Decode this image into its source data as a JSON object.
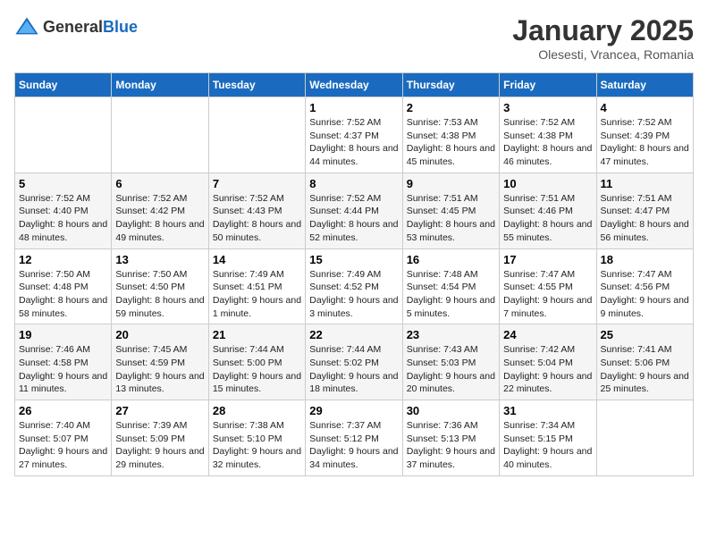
{
  "logo": {
    "general": "General",
    "blue": "Blue"
  },
  "title": {
    "month": "January 2025",
    "location": "Olesesti, Vrancea, Romania"
  },
  "weekdays": [
    "Sunday",
    "Monday",
    "Tuesday",
    "Wednesday",
    "Thursday",
    "Friday",
    "Saturday"
  ],
  "weeks": [
    [
      {
        "day": "",
        "sunrise": "",
        "sunset": "",
        "daylight": ""
      },
      {
        "day": "",
        "sunrise": "",
        "sunset": "",
        "daylight": ""
      },
      {
        "day": "",
        "sunrise": "",
        "sunset": "",
        "daylight": ""
      },
      {
        "day": "1",
        "sunrise": "Sunrise: 7:52 AM",
        "sunset": "Sunset: 4:37 PM",
        "daylight": "Daylight: 8 hours and 44 minutes."
      },
      {
        "day": "2",
        "sunrise": "Sunrise: 7:53 AM",
        "sunset": "Sunset: 4:38 PM",
        "daylight": "Daylight: 8 hours and 45 minutes."
      },
      {
        "day": "3",
        "sunrise": "Sunrise: 7:52 AM",
        "sunset": "Sunset: 4:38 PM",
        "daylight": "Daylight: 8 hours and 46 minutes."
      },
      {
        "day": "4",
        "sunrise": "Sunrise: 7:52 AM",
        "sunset": "Sunset: 4:39 PM",
        "daylight": "Daylight: 8 hours and 47 minutes."
      }
    ],
    [
      {
        "day": "5",
        "sunrise": "Sunrise: 7:52 AM",
        "sunset": "Sunset: 4:40 PM",
        "daylight": "Daylight: 8 hours and 48 minutes."
      },
      {
        "day": "6",
        "sunrise": "Sunrise: 7:52 AM",
        "sunset": "Sunset: 4:42 PM",
        "daylight": "Daylight: 8 hours and 49 minutes."
      },
      {
        "day": "7",
        "sunrise": "Sunrise: 7:52 AM",
        "sunset": "Sunset: 4:43 PM",
        "daylight": "Daylight: 8 hours and 50 minutes."
      },
      {
        "day": "8",
        "sunrise": "Sunrise: 7:52 AM",
        "sunset": "Sunset: 4:44 PM",
        "daylight": "Daylight: 8 hours and 52 minutes."
      },
      {
        "day": "9",
        "sunrise": "Sunrise: 7:51 AM",
        "sunset": "Sunset: 4:45 PM",
        "daylight": "Daylight: 8 hours and 53 minutes."
      },
      {
        "day": "10",
        "sunrise": "Sunrise: 7:51 AM",
        "sunset": "Sunset: 4:46 PM",
        "daylight": "Daylight: 8 hours and 55 minutes."
      },
      {
        "day": "11",
        "sunrise": "Sunrise: 7:51 AM",
        "sunset": "Sunset: 4:47 PM",
        "daylight": "Daylight: 8 hours and 56 minutes."
      }
    ],
    [
      {
        "day": "12",
        "sunrise": "Sunrise: 7:50 AM",
        "sunset": "Sunset: 4:48 PM",
        "daylight": "Daylight: 8 hours and 58 minutes."
      },
      {
        "day": "13",
        "sunrise": "Sunrise: 7:50 AM",
        "sunset": "Sunset: 4:50 PM",
        "daylight": "Daylight: 8 hours and 59 minutes."
      },
      {
        "day": "14",
        "sunrise": "Sunrise: 7:49 AM",
        "sunset": "Sunset: 4:51 PM",
        "daylight": "Daylight: 9 hours and 1 minute."
      },
      {
        "day": "15",
        "sunrise": "Sunrise: 7:49 AM",
        "sunset": "Sunset: 4:52 PM",
        "daylight": "Daylight: 9 hours and 3 minutes."
      },
      {
        "day": "16",
        "sunrise": "Sunrise: 7:48 AM",
        "sunset": "Sunset: 4:54 PM",
        "daylight": "Daylight: 9 hours and 5 minutes."
      },
      {
        "day": "17",
        "sunrise": "Sunrise: 7:47 AM",
        "sunset": "Sunset: 4:55 PM",
        "daylight": "Daylight: 9 hours and 7 minutes."
      },
      {
        "day": "18",
        "sunrise": "Sunrise: 7:47 AM",
        "sunset": "Sunset: 4:56 PM",
        "daylight": "Daylight: 9 hours and 9 minutes."
      }
    ],
    [
      {
        "day": "19",
        "sunrise": "Sunrise: 7:46 AM",
        "sunset": "Sunset: 4:58 PM",
        "daylight": "Daylight: 9 hours and 11 minutes."
      },
      {
        "day": "20",
        "sunrise": "Sunrise: 7:45 AM",
        "sunset": "Sunset: 4:59 PM",
        "daylight": "Daylight: 9 hours and 13 minutes."
      },
      {
        "day": "21",
        "sunrise": "Sunrise: 7:44 AM",
        "sunset": "Sunset: 5:00 PM",
        "daylight": "Daylight: 9 hours and 15 minutes."
      },
      {
        "day": "22",
        "sunrise": "Sunrise: 7:44 AM",
        "sunset": "Sunset: 5:02 PM",
        "daylight": "Daylight: 9 hours and 18 minutes."
      },
      {
        "day": "23",
        "sunrise": "Sunrise: 7:43 AM",
        "sunset": "Sunset: 5:03 PM",
        "daylight": "Daylight: 9 hours and 20 minutes."
      },
      {
        "day": "24",
        "sunrise": "Sunrise: 7:42 AM",
        "sunset": "Sunset: 5:04 PM",
        "daylight": "Daylight: 9 hours and 22 minutes."
      },
      {
        "day": "25",
        "sunrise": "Sunrise: 7:41 AM",
        "sunset": "Sunset: 5:06 PM",
        "daylight": "Daylight: 9 hours and 25 minutes."
      }
    ],
    [
      {
        "day": "26",
        "sunrise": "Sunrise: 7:40 AM",
        "sunset": "Sunset: 5:07 PM",
        "daylight": "Daylight: 9 hours and 27 minutes."
      },
      {
        "day": "27",
        "sunrise": "Sunrise: 7:39 AM",
        "sunset": "Sunset: 5:09 PM",
        "daylight": "Daylight: 9 hours and 29 minutes."
      },
      {
        "day": "28",
        "sunrise": "Sunrise: 7:38 AM",
        "sunset": "Sunset: 5:10 PM",
        "daylight": "Daylight: 9 hours and 32 minutes."
      },
      {
        "day": "29",
        "sunrise": "Sunrise: 7:37 AM",
        "sunset": "Sunset: 5:12 PM",
        "daylight": "Daylight: 9 hours and 34 minutes."
      },
      {
        "day": "30",
        "sunrise": "Sunrise: 7:36 AM",
        "sunset": "Sunset: 5:13 PM",
        "daylight": "Daylight: 9 hours and 37 minutes."
      },
      {
        "day": "31",
        "sunrise": "Sunrise: 7:34 AM",
        "sunset": "Sunset: 5:15 PM",
        "daylight": "Daylight: 9 hours and 40 minutes."
      },
      {
        "day": "",
        "sunrise": "",
        "sunset": "",
        "daylight": ""
      }
    ]
  ]
}
